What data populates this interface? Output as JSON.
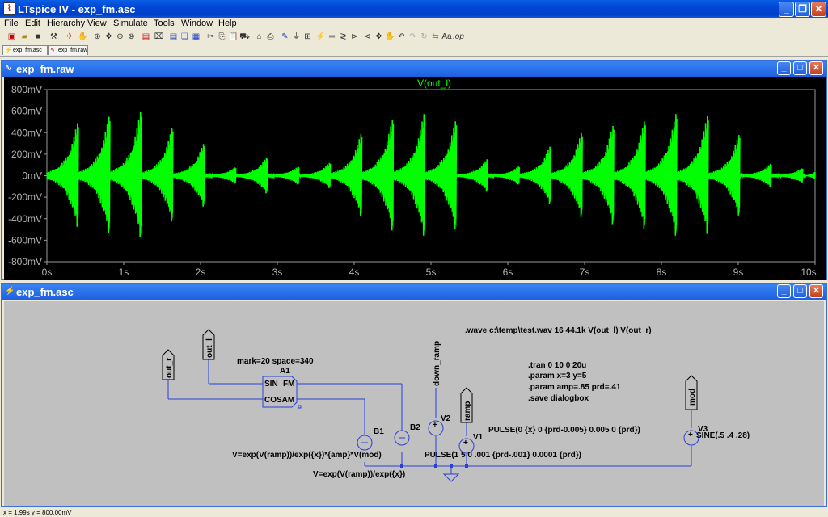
{
  "window": {
    "title": "LTspice IV - exp_fm.asc"
  },
  "menu": [
    "File",
    "Edit",
    "Hierarchy",
    "View",
    "Simulate",
    "Tools",
    "Window",
    "Help"
  ],
  "tabs": [
    "exp_fm.asc",
    "exp_fm.raw"
  ],
  "waveform_window": {
    "title": "exp_fm.raw",
    "trace_label": "V(out_l)",
    "trace_color": "#00ff00"
  },
  "schematic_window": {
    "title": "exp_fm.asc"
  },
  "chart_data": {
    "type": "line",
    "title": "V(out_l)",
    "series": [
      {
        "name": "V(out_l)",
        "color": "#00ff00"
      }
    ],
    "x_ticks": [
      "0s",
      "1s",
      "2s",
      "3s",
      "4s",
      "5s",
      "6s",
      "7s",
      "8s",
      "9s",
      "10s"
    ],
    "y_ticks": [
      "800mV",
      "600mV",
      "400mV",
      "200mV",
      "0mV",
      "-200mV",
      "-400mV",
      "-600mV",
      "-800mV"
    ],
    "xlim": [
      0,
      10
    ],
    "ylim": [
      -0.8,
      0.8
    ],
    "grid": false,
    "envelope_segments": [
      {
        "t_start": 0.0,
        "t_end": 0.41,
        "peak": 0.58
      },
      {
        "t_start": 0.41,
        "t_end": 0.82,
        "peak": 0.65
      },
      {
        "t_start": 0.82,
        "t_end": 1.23,
        "peak": 0.7
      },
      {
        "t_start": 1.23,
        "t_end": 1.64,
        "peak": 0.52
      },
      {
        "t_start": 1.64,
        "t_end": 2.05,
        "peak": 0.35
      },
      {
        "t_start": 2.05,
        "t_end": 2.46,
        "peak": 0.09
      },
      {
        "t_start": 2.46,
        "t_end": 2.87,
        "peak": 0.2
      },
      {
        "t_start": 2.87,
        "t_end": 3.28,
        "peak": 0.1
      },
      {
        "t_start": 3.28,
        "t_end": 3.69,
        "peak": 0.14
      },
      {
        "t_start": 3.69,
        "t_end": 4.1,
        "peak": 0.46
      },
      {
        "t_start": 4.1,
        "t_end": 4.51,
        "peak": 0.62
      },
      {
        "t_start": 4.51,
        "t_end": 4.92,
        "peak": 0.68
      },
      {
        "t_start": 4.92,
        "t_end": 5.33,
        "peak": 0.6
      },
      {
        "t_start": 5.33,
        "t_end": 5.74,
        "peak": 0.18
      },
      {
        "t_start": 5.74,
        "t_end": 6.15,
        "peak": 0.1
      },
      {
        "t_start": 6.15,
        "t_end": 6.56,
        "peak": 0.32
      },
      {
        "t_start": 6.56,
        "t_end": 6.97,
        "peak": 0.47
      },
      {
        "t_start": 6.97,
        "t_end": 7.38,
        "peak": 0.55
      },
      {
        "t_start": 7.38,
        "t_end": 7.79,
        "peak": 0.6
      },
      {
        "t_start": 7.79,
        "t_end": 8.2,
        "peak": 0.68
      },
      {
        "t_start": 8.2,
        "t_end": 8.61,
        "peak": 0.66
      },
      {
        "t_start": 8.61,
        "t_end": 9.02,
        "peak": 0.45
      },
      {
        "t_start": 9.02,
        "t_end": 9.43,
        "peak": 0.13
      },
      {
        "t_start": 9.43,
        "t_end": 9.84,
        "peak": 0.08
      },
      {
        "t_start": 9.84,
        "t_end": 10.0,
        "peak": 0.04
      }
    ]
  },
  "schematic": {
    "directive_wave": ".wave c:\\temp\\test.wav 16 44.1k V(out_l) V(out_r)",
    "directive_tran": ".tran 0 10 0 20u",
    "directive_param1": ".param  x=3     y=5",
    "directive_param2": ".param amp=.85   prd=.41",
    "directive_save": ".save dialogbox",
    "mark_space": "mark=20 space=340",
    "a1_name": "A1",
    "a1_sin": "SIN",
    "a1_fm": "FM",
    "a1_cosam": "COSAM",
    "label_out_r": "out_r",
    "label_out_l": "out_l",
    "label_down_ramp": "down_ramp",
    "label_ramp": "ramp",
    "label_mod": "mod",
    "b1_name": "B1",
    "b2_name": "B2",
    "v1_name": "V1",
    "v2_name": "V2",
    "v3_name": "V3",
    "b1_value": "V=exp(V(ramp))/exp({x})*{amp}*V(mod)",
    "b2_value": "V=exp(V(ramp))/exp({x})",
    "v1_value": "PULSE(0 {x} 0 {prd-0.005} 0.005 0 {prd})",
    "v2_value": "PULSE(1 5 0 .001 {prd-.001} 0.0001 {prd})",
    "v3_value": "SINE(.5 .4 .28)"
  },
  "status": {
    "text": "x = 1.99s    y = 800.00mV"
  }
}
